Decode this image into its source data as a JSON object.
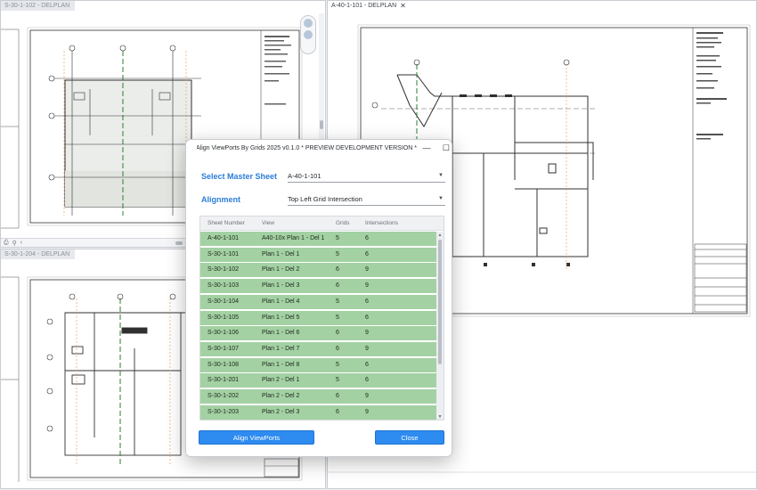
{
  "views": {
    "top_left": {
      "tab": "S-30-1-102 - DELPLAN"
    },
    "bottom_left": {
      "tab": "S-30-1-204 - DELPLAN"
    },
    "right": {
      "tab": "A-40-1-101 - DELPLAN",
      "close": "✕"
    }
  },
  "dialog": {
    "title": "Align ViewPorts By Grids 2025 v0.1.0 * PREVIEW DEVELOPMENT VERSION *",
    "minimize": "—",
    "maximize": "☐",
    "close": "✕",
    "master_sheet": {
      "label": "Select Master Sheet",
      "value": "A-40-1-101"
    },
    "alignment": {
      "label": "Alignment",
      "value": "Top Left Grid Intersection"
    },
    "table": {
      "columns": [
        "Sheet Number",
        "View",
        "Grids",
        "Intersections"
      ],
      "rows": [
        {
          "sheet": "A-40-1-101",
          "view": "A40-10x Plan 1 - Del 1",
          "grids": "5",
          "intersections": "6"
        },
        {
          "sheet": "S-30-1-101",
          "view": "Plan 1 - Del 1",
          "grids": "5",
          "intersections": "6"
        },
        {
          "sheet": "S-30-1-102",
          "view": "Plan 1 - Del 2",
          "grids": "6",
          "intersections": "9"
        },
        {
          "sheet": "S-30-1-103",
          "view": "Plan 1 - Del 3",
          "grids": "6",
          "intersections": "9"
        },
        {
          "sheet": "S-30-1-104",
          "view": "Plan 1 - Del 4",
          "grids": "5",
          "intersections": "6"
        },
        {
          "sheet": "S-30-1-105",
          "view": "Plan 1 - Del 5",
          "grids": "5",
          "intersections": "6"
        },
        {
          "sheet": "S-30-1-106",
          "view": "Plan 1 - Del 6",
          "grids": "6",
          "intersections": "9"
        },
        {
          "sheet": "S-30-1-107",
          "view": "Plan 1 - Del 7",
          "grids": "6",
          "intersections": "9"
        },
        {
          "sheet": "S-30-1-108",
          "view": "Plan 1 - Del 8",
          "grids": "5",
          "intersections": "6"
        },
        {
          "sheet": "S-30-1-201",
          "view": "Plan 2 - Del 1",
          "grids": "5",
          "intersections": "6"
        },
        {
          "sheet": "S-30-1-202",
          "view": "Plan 2 - Del 2",
          "grids": "6",
          "intersections": "9"
        },
        {
          "sheet": "S-30-1-203",
          "view": "Plan 2 - Del 3",
          "grids": "6",
          "intersections": "9"
        }
      ]
    },
    "buttons": {
      "align": "Align ViewPorts",
      "close": "Close"
    }
  },
  "colors": {
    "accent": "#2b7dd8",
    "row_fill": "#a3d1a3",
    "button": "#2e8bf0"
  }
}
